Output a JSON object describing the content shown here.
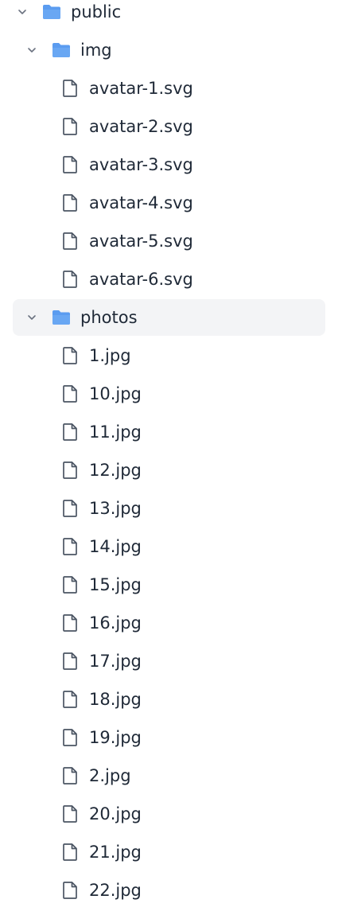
{
  "tree": {
    "root": {
      "name": "public",
      "icon": "folder-icon",
      "expanded": true
    },
    "img": {
      "name": "img",
      "icon": "folder-icon",
      "expanded": true,
      "files": [
        "avatar-1.svg",
        "avatar-2.svg",
        "avatar-3.svg",
        "avatar-4.svg",
        "avatar-5.svg",
        "avatar-6.svg"
      ]
    },
    "photos": {
      "name": "photos",
      "icon": "folder-icon",
      "expanded": true,
      "selected": true,
      "files": [
        "1.jpg",
        "10.jpg",
        "11.jpg",
        "12.jpg",
        "13.jpg",
        "14.jpg",
        "15.jpg",
        "16.jpg",
        "17.jpg",
        "18.jpg",
        "19.jpg",
        "2.jpg",
        "20.jpg",
        "21.jpg",
        "22.jpg"
      ]
    }
  },
  "colors": {
    "folder": "#5b9cf0",
    "folder_dark": "#4a8ae6",
    "file_stroke": "#4b5563",
    "chevron": "#6b7280",
    "hover_bg": "#f3f4f6",
    "text": "#1f2937"
  }
}
